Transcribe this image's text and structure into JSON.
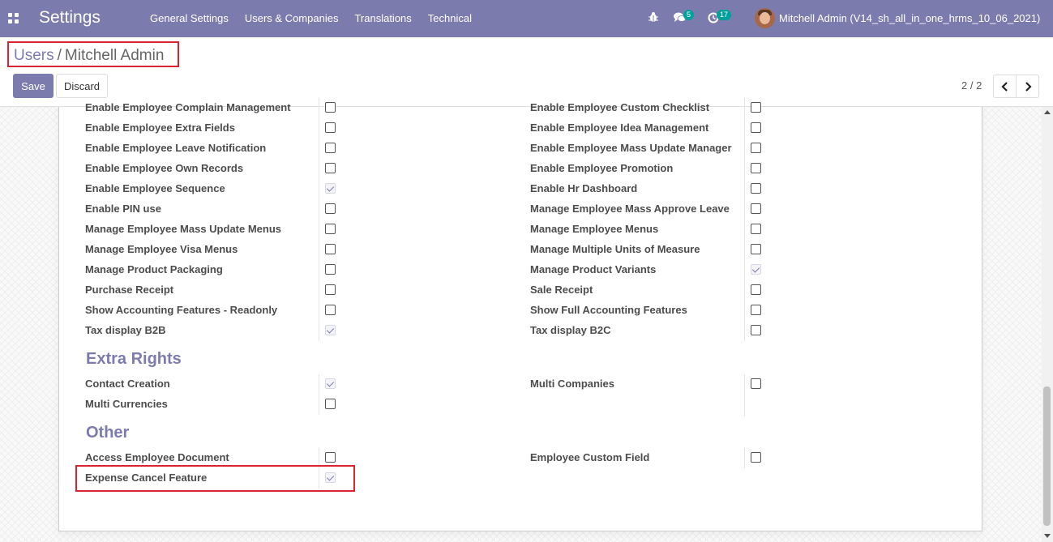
{
  "navbar": {
    "title": "Settings",
    "menu": [
      "General Settings",
      "Users & Companies",
      "Translations",
      "Technical"
    ],
    "chat_count": "5",
    "activity_count": "17",
    "user": "Mitchell Admin (V14_sh_all_in_one_hrms_10_06_2021)"
  },
  "breadcrumb": {
    "parent": "Users",
    "current": "Mitchell Admin"
  },
  "buttons": {
    "save": "Save",
    "discard": "Discard"
  },
  "pager": {
    "value": "2 / 2"
  },
  "rights": {
    "left": [
      {
        "label": "Enable Employee Complain Management",
        "checked": false
      },
      {
        "label": "Enable Employee Extra Fields",
        "checked": false
      },
      {
        "label": "Enable Employee Leave Notification",
        "checked": false
      },
      {
        "label": "Enable Employee Own Records",
        "checked": false
      },
      {
        "label": "Enable Employee Sequence",
        "checked": true
      },
      {
        "label": "Enable PIN use",
        "checked": false
      },
      {
        "label": "Manage Employee Mass Update Menus",
        "checked": false
      },
      {
        "label": "Manage Employee Visa Menus",
        "checked": false
      },
      {
        "label": "Manage Product Packaging",
        "checked": false
      },
      {
        "label": "Purchase Receipt",
        "checked": false
      },
      {
        "label": "Show Accounting Features - Readonly",
        "checked": false
      },
      {
        "label": "Tax display B2B",
        "checked": true
      }
    ],
    "right": [
      {
        "label": "Enable Employee Custom Checklist",
        "checked": false
      },
      {
        "label": "Enable Employee Idea Management",
        "checked": false
      },
      {
        "label": "Enable Employee Mass Update Manager",
        "checked": false
      },
      {
        "label": "Enable Employee Promotion",
        "checked": false
      },
      {
        "label": "Enable Hr Dashboard",
        "checked": false
      },
      {
        "label": "Manage Employee Mass Approve Leave",
        "checked": false
      },
      {
        "label": "Manage Employee Menus",
        "checked": false
      },
      {
        "label": "Manage Multiple Units of Measure",
        "checked": false
      },
      {
        "label": "Manage Product Variants",
        "checked": true
      },
      {
        "label": "Sale Receipt",
        "checked": false
      },
      {
        "label": "Show Full Accounting Features",
        "checked": false
      },
      {
        "label": "Tax display B2C",
        "checked": false
      }
    ]
  },
  "extra_rights": {
    "title": "Extra Rights",
    "left": [
      {
        "label": "Contact Creation",
        "checked": true
      },
      {
        "label": "Multi Currencies",
        "checked": false
      }
    ],
    "right": [
      {
        "label": "Multi Companies",
        "checked": false
      }
    ]
  },
  "other": {
    "title": "Other",
    "left": [
      {
        "label": "Access Employee Document",
        "checked": false
      },
      {
        "label": "Expense Cancel Feature",
        "checked": true
      }
    ],
    "right": [
      {
        "label": "Employee Custom Field",
        "checked": false
      }
    ]
  },
  "icons": [
    "apps-icon",
    "bug-icon",
    "chat-icon",
    "clock-icon",
    "chevron-left-icon",
    "chevron-right-icon",
    "check-icon"
  ],
  "colors": {
    "brand": "#7c7bad",
    "badge": "#00a09d",
    "highlight": "#d9232d"
  }
}
